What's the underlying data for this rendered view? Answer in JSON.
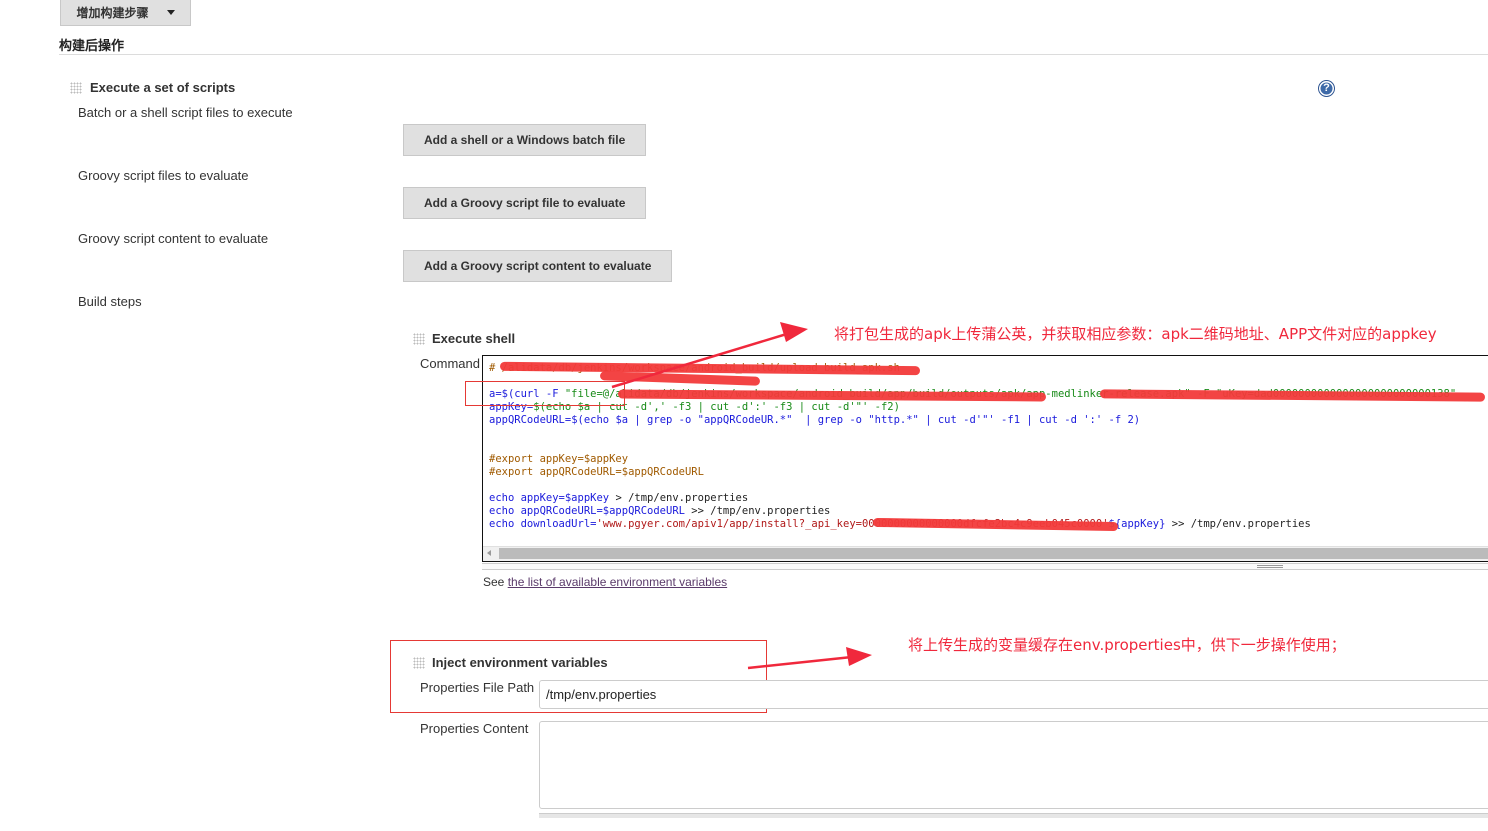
{
  "top_button": {
    "label": "增加构建步骤"
  },
  "post_build": {
    "title": "构建后操作"
  },
  "execute_scripts": {
    "title": "Execute a set of scripts",
    "rows": [
      {
        "label": "Batch or a shell script files to execute",
        "button": "Add a shell or a Windows batch file"
      },
      {
        "label": "Groovy script files to evaluate",
        "button": "Add a Groovy script file to evaluate"
      },
      {
        "label": "Groovy script content to evaluate",
        "button": "Add a Groovy script content to evaluate"
      },
      {
        "label": "Build steps"
      }
    ],
    "help_icon": "?"
  },
  "execute_shell": {
    "title": "Execute shell",
    "command_label": "Command",
    "code": {
      "line1": "# /alidata/db/jenkins/workspace/android_build/upload_build_apk.sh",
      "line2_prefix": "a=$(curl -F ",
      "line2_str": "\"file=@/alidata/db/jenkins/workspace/android_build/app/build/outputs/apk/app-medlinker-release.apk\" -F \"uKey=dad0000000000000000000000000138\"",
      "line3_prefix": "appKey=",
      "line3_rest": "$(echo $a | cut -d',' -f3 | cut -d':' -f3 | cut -d'\"' -f2)",
      "line4_prefix": "appQRCodeURL=",
      "line4_rest": "$(echo $a | grep -o \"appQRCodeUR.*\"  | grep -o \"http.*\" | cut -d'\"' -f1 | cut -d ':' -f 2)",
      "line5": "#export appKey=$appKey",
      "line6": "#export appQRCodeURL=$appQRCodeURL",
      "line7_echo": "echo ",
      "line7_var": "appKey=$appKey",
      "line7_rest": " > /tmp/env.properties",
      "line8_echo": "echo ",
      "line8_var": "appQRCodeURL=$appQRCodeURL",
      "line8_rest": " >> /tmp/env.properties",
      "line9_echo": "echo ",
      "line9_var": "downloadUrl=",
      "line9_str": "'www.pgyer.com/apiv1/app/install?_api_key=0000000000000000dfcfe2bc4c9eeb045c0000'",
      "line9_var2": "${appKey}",
      "line9_rest": " >> /tmp/env.properties"
    },
    "see_prefix": "See ",
    "see_link": "the list of available environment variables"
  },
  "annotations": {
    "upload_note": "将打包生成的apk上传蒲公英，并获取相应参数：apk二维码地址、APP文件对应的appkey",
    "cache_note": "将上传生成的变量缓存在env.properties中，供下一步操作使用；"
  },
  "inject_env": {
    "title": "Inject environment variables",
    "file_path_label": "Properties File Path",
    "file_path_value": "/tmp/env.properties",
    "content_label": "Properties Content",
    "content_value": ""
  },
  "colors": {
    "annotation_red": "#f0283c",
    "help_blue": "#3e6aa8",
    "link_purple": "#5a3a6a"
  }
}
